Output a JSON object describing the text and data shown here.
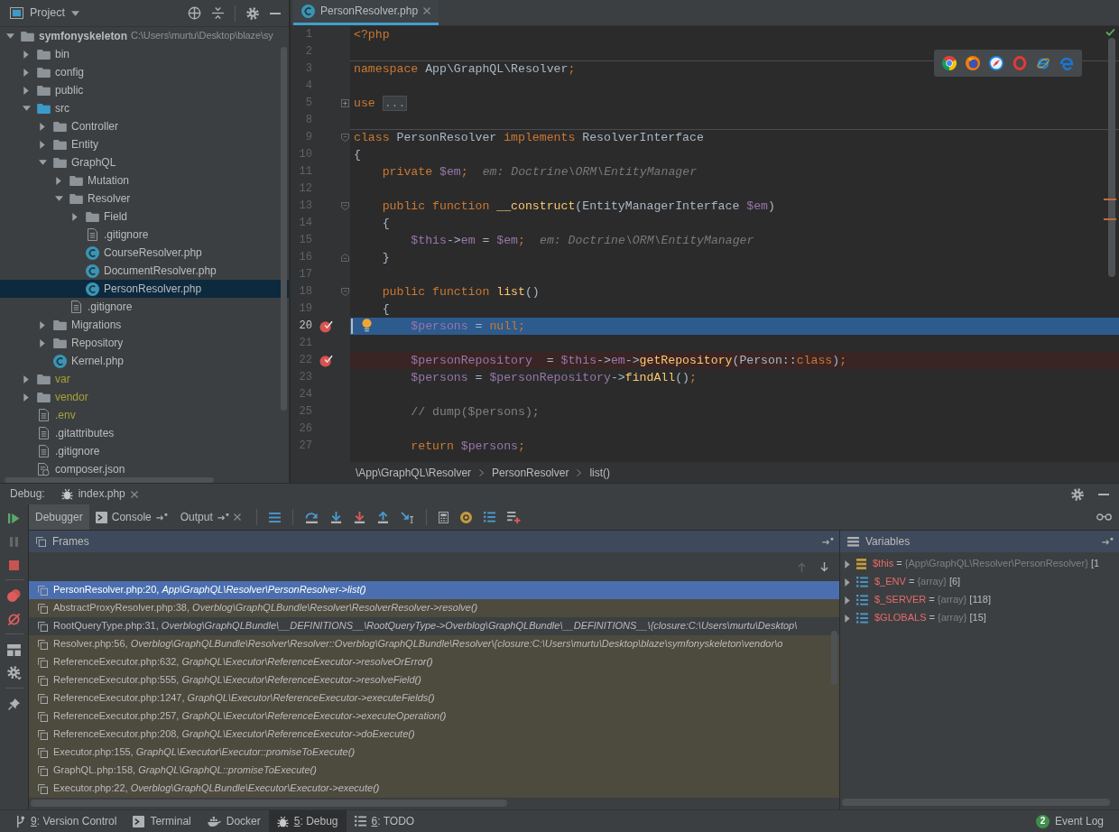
{
  "project": {
    "title": "Project",
    "tree": [
      {
        "label": "symfonyskeleton",
        "path": "C:\\Users\\murtu\\Desktop\\blaze\\sy",
        "kind": "module",
        "expanded": true,
        "selected": false,
        "ignored": false,
        "children": [
          {
            "label": "bin",
            "kind": "folder",
            "expanded": false,
            "selected": false,
            "ignored": false
          },
          {
            "label": "config",
            "kind": "folder",
            "expanded": false,
            "selected": false,
            "ignored": false
          },
          {
            "label": "public",
            "kind": "folder",
            "expanded": false,
            "selected": false,
            "ignored": false
          },
          {
            "label": "src",
            "kind": "source_folder",
            "expanded": true,
            "selected": false,
            "ignored": false,
            "children": [
              {
                "label": "Controller",
                "kind": "folder",
                "expanded": false,
                "selected": false,
                "ignored": false
              },
              {
                "label": "Entity",
                "kind": "folder",
                "expanded": false,
                "selected": false,
                "ignored": false
              },
              {
                "label": "GraphQL",
                "kind": "folder",
                "expanded": true,
                "selected": false,
                "ignored": false,
                "children": [
                  {
                    "label": "Mutation",
                    "kind": "folder",
                    "expanded": false,
                    "selected": false,
                    "ignored": false
                  },
                  {
                    "label": "Resolver",
                    "kind": "folder",
                    "expanded": true,
                    "selected": false,
                    "ignored": false,
                    "children": [
                      {
                        "label": "Field",
                        "kind": "folder",
                        "expanded": false,
                        "selected": false,
                        "ignored": false
                      },
                      {
                        "label": ".gitignore",
                        "kind": "text_file",
                        "selected": false,
                        "ignored": false
                      },
                      {
                        "label": "CourseResolver.php",
                        "kind": "class_file",
                        "selected": false,
                        "ignored": false
                      },
                      {
                        "label": "DocumentResolver.php",
                        "kind": "class_file",
                        "selected": false,
                        "ignored": false
                      },
                      {
                        "label": "PersonResolver.php",
                        "kind": "class_file",
                        "selected": true,
                        "ignored": false
                      }
                    ]
                  },
                  {
                    "label": ".gitignore",
                    "kind": "text_file",
                    "selected": false,
                    "ignored": false
                  }
                ]
              },
              {
                "label": "Migrations",
                "kind": "folder",
                "expanded": false,
                "selected": false,
                "ignored": false
              },
              {
                "label": "Repository",
                "kind": "folder",
                "expanded": false,
                "selected": false,
                "ignored": false
              },
              {
                "label": "Kernel.php",
                "kind": "class_file",
                "selected": false,
                "ignored": false
              }
            ]
          },
          {
            "label": "var",
            "kind": "folder",
            "expanded": false,
            "selected": false,
            "ignored": true
          },
          {
            "label": "vendor",
            "kind": "folder",
            "expanded": false,
            "selected": false,
            "ignored": true
          },
          {
            "label": ".env",
            "kind": "text_file",
            "selected": false,
            "ignored": true
          },
          {
            "label": ".gitattributes",
            "kind": "text_file",
            "selected": false,
            "ignored": false
          },
          {
            "label": ".gitignore",
            "kind": "text_file",
            "selected": false,
            "ignored": false
          },
          {
            "label": "composer.json",
            "kind": "json_file",
            "selected": false,
            "ignored": false
          }
        ]
      }
    ]
  },
  "editor": {
    "tab": {
      "label": "PersonResolver.php",
      "selected": true
    },
    "lines": [
      {
        "number": "1",
        "breakpoint": false,
        "current": false,
        "tokens": [
          {
            "kind": "keyword",
            "text": "<?php"
          }
        ]
      },
      {
        "number": "2",
        "breakpoint": false,
        "current": false
      },
      {
        "number": "3",
        "breakpoint": false,
        "current": false,
        "separator": true,
        "tokens": [
          {
            "kind": "keyword",
            "text": "namespace"
          },
          {
            "kind": "plain",
            "text": " App\\GraphQL\\Resolver"
          },
          {
            "kind": "keyword",
            "text": ";"
          }
        ]
      },
      {
        "number": "4",
        "breakpoint": false,
        "current": false
      },
      {
        "number": "5",
        "breakpoint": false,
        "current": false,
        "fold": {
          "kind": "collapsed"
        },
        "tokens": [
          {
            "kind": "keyword",
            "text": "use "
          },
          {
            "kind": "folded",
            "text": "..."
          }
        ]
      },
      {
        "number": "8",
        "breakpoint": false,
        "current": false
      },
      {
        "number": "9",
        "breakpoint": false,
        "current": false,
        "separator": true,
        "fold": {
          "kind": "open"
        },
        "tokens": [
          {
            "kind": "keyword",
            "text": "class"
          },
          {
            "kind": "plain",
            "text": " PersonResolver "
          },
          {
            "kind": "keyword",
            "text": "implements"
          },
          {
            "kind": "plain",
            "text": " ResolverInterface"
          }
        ]
      },
      {
        "number": "10",
        "breakpoint": false,
        "current": false,
        "tokens": [
          {
            "kind": "plain",
            "text": "{"
          }
        ]
      },
      {
        "number": "11",
        "breakpoint": false,
        "current": false,
        "tokens": [
          {
            "kind": "keyword",
            "text": "    private "
          },
          {
            "kind": "variable",
            "text": "$em"
          },
          {
            "kind": "keyword",
            "text": ";"
          },
          {
            "kind": "hint",
            "text": "em: Doctrine\\ORM\\EntityManager"
          }
        ]
      },
      {
        "number": "12",
        "breakpoint": false,
        "current": false
      },
      {
        "number": "13",
        "breakpoint": false,
        "current": false,
        "fold": {
          "kind": "open"
        },
        "tokens": [
          {
            "kind": "keyword",
            "text": "    public function "
          },
          {
            "kind": "function",
            "text": "__construct"
          },
          {
            "kind": "plain",
            "text": "(EntityManagerInterface "
          },
          {
            "kind": "variable",
            "text": "$em"
          },
          {
            "kind": "plain",
            "text": ")"
          }
        ]
      },
      {
        "number": "14",
        "breakpoint": false,
        "current": false,
        "tokens": [
          {
            "kind": "plain",
            "text": "    {"
          }
        ]
      },
      {
        "number": "15",
        "breakpoint": false,
        "current": false,
        "tokens": [
          {
            "kind": "variable",
            "text": "        $this"
          },
          {
            "kind": "plain",
            "text": "->"
          },
          {
            "kind": "variable",
            "text": "em"
          },
          {
            "kind": "plain",
            "text": " = "
          },
          {
            "kind": "variable",
            "text": "$em"
          },
          {
            "kind": "keyword",
            "text": ";"
          },
          {
            "kind": "hint",
            "text": "em: Doctrine\\ORM\\EntityManager"
          }
        ]
      },
      {
        "number": "16",
        "breakpoint": false,
        "current": false,
        "fold": {
          "kind": "close"
        },
        "tokens": [
          {
            "kind": "plain",
            "text": "    }"
          }
        ]
      },
      {
        "number": "17",
        "breakpoint": false,
        "current": false
      },
      {
        "number": "18",
        "breakpoint": false,
        "current": false,
        "fold": {
          "kind": "open"
        },
        "tokens": [
          {
            "kind": "keyword",
            "text": "    public function "
          },
          {
            "kind": "function",
            "text": "list"
          },
          {
            "kind": "plain",
            "text": "()"
          }
        ]
      },
      {
        "number": "19",
        "breakpoint": false,
        "current": false,
        "tokens": [
          {
            "kind": "plain",
            "text": "    {"
          }
        ]
      },
      {
        "number": "20",
        "breakpoint": true,
        "current": true,
        "caret": true,
        "bulb": true,
        "tokens": [
          {
            "kind": "variable",
            "text": "        $persons"
          },
          {
            "kind": "plain",
            "text": " = "
          },
          {
            "kind": "keyword",
            "text": "null"
          },
          {
            "kind": "keyword",
            "text": ";"
          }
        ]
      },
      {
        "number": "21",
        "breakpoint": false,
        "current": false
      },
      {
        "number": "22",
        "breakpoint": true,
        "current": false,
        "tokens": [
          {
            "kind": "variable",
            "text": "        $personRepository"
          },
          {
            "kind": "plain",
            "text": "  = "
          },
          {
            "kind": "variable",
            "text": "$this"
          },
          {
            "kind": "plain",
            "text": "->"
          },
          {
            "kind": "variable",
            "text": "em"
          },
          {
            "kind": "plain",
            "text": "->"
          },
          {
            "kind": "function",
            "text": "getRepository"
          },
          {
            "kind": "plain",
            "text": "(Person::"
          },
          {
            "kind": "keyword",
            "text": "class"
          },
          {
            "kind": "plain",
            "text": ")"
          },
          {
            "kind": "keyword",
            "text": ";"
          }
        ]
      },
      {
        "number": "23",
        "breakpoint": false,
        "current": false,
        "tokens": [
          {
            "kind": "variable",
            "text": "        $persons"
          },
          {
            "kind": "plain",
            "text": " = "
          },
          {
            "kind": "variable",
            "text": "$personRepository"
          },
          {
            "kind": "plain",
            "text": "->"
          },
          {
            "kind": "function",
            "text": "findAll"
          },
          {
            "kind": "plain",
            "text": "()"
          },
          {
            "kind": "keyword",
            "text": ";"
          }
        ]
      },
      {
        "number": "24",
        "breakpoint": false,
        "current": false
      },
      {
        "number": "25",
        "breakpoint": false,
        "current": false,
        "tokens": [
          {
            "kind": "comment",
            "text": "        // dump($persons);"
          }
        ]
      },
      {
        "number": "26",
        "breakpoint": false,
        "current": false
      },
      {
        "number": "27",
        "breakpoint": false,
        "current": false,
        "tokens": [
          {
            "kind": "keyword",
            "text": "        return "
          },
          {
            "kind": "variable",
            "text": "$persons"
          },
          {
            "kind": "keyword",
            "text": ";"
          }
        ]
      }
    ],
    "breadcrumbs": [
      "\\App\\GraphQL\\Resolver",
      "PersonResolver",
      "list()"
    ]
  },
  "debug": {
    "title": "Debug:",
    "session_tab": "index.php",
    "tabs": [
      {
        "label": "Debugger",
        "kind": "debugger",
        "selected": true
      },
      {
        "label": "Console",
        "kind": "console",
        "selected": false
      },
      {
        "label": "Output",
        "kind": "output",
        "selected": false
      }
    ],
    "frames": {
      "title": "Frames",
      "rows": [
        {
          "text": "PersonResolver.php:20, *App\\GraphQL\\Resolver\\PersonResolver->list()*",
          "selected": true,
          "library": false
        },
        {
          "text": "AbstractProxyResolver.php:38, *Overblog\\GraphQLBundle\\Resolver\\ResolverResolver->resolve()*",
          "selected": false,
          "library": true
        },
        {
          "text": "RootQueryType.php:31, *Overblog\\GraphQLBundle\\__DEFINITIONS__\\RootQueryType->Overblog\\GraphQLBundle\\__DEFINITIONS__\\{closure:C:\\Users\\murtu\\Desktop\\*",
          "selected": false,
          "library": false
        },
        {
          "text": "Resolver.php:56, *Overblog\\GraphQLBundle\\Resolver\\Resolver::Overblog\\GraphQLBundle\\Resolver\\{closure:C:\\Users\\murtu\\Desktop\\blaze\\symfonyskeleton\\vendor\\o*",
          "selected": false,
          "library": true
        },
        {
          "text": "ReferenceExecutor.php:632, *GraphQL\\Executor\\ReferenceExecutor->resolveOrError()*",
          "selected": false,
          "library": true
        },
        {
          "text": "ReferenceExecutor.php:555, *GraphQL\\Executor\\ReferenceExecutor->resolveField()*",
          "selected": false,
          "library": true
        },
        {
          "text": "ReferenceExecutor.php:1247, *GraphQL\\Executor\\ReferenceExecutor->executeFields()*",
          "selected": false,
          "library": true
        },
        {
          "text": "ReferenceExecutor.php:257, *GraphQL\\Executor\\ReferenceExecutor->executeOperation()*",
          "selected": false,
          "library": true
        },
        {
          "text": "ReferenceExecutor.php:208, *GraphQL\\Executor\\ReferenceExecutor->doExecute()*",
          "selected": false,
          "library": true
        },
        {
          "text": "Executor.php:155, *GraphQL\\Executor\\Executor::promiseToExecute()*",
          "selected": false,
          "library": true
        },
        {
          "text": "GraphQL.php:158, *GraphQL\\GraphQL::promiseToExecute()*",
          "selected": false,
          "library": true
        },
        {
          "text": "Executor.php:22, *Overblog\\GraphQLBundle\\Executor\\Executor->execute()*",
          "selected": false,
          "library": true
        }
      ]
    },
    "variables": {
      "title": "Variables",
      "rows": [
        {
          "name": "$this",
          "equals": "=",
          "type": "{App\\GraphQL\\Resolver\\PersonResolver}",
          "size": "[1",
          "kind": "object",
          "expanded": false
        },
        {
          "name": "$_ENV",
          "equals": "=",
          "type": "{array}",
          "size": "[6]",
          "kind": "array",
          "expanded": false
        },
        {
          "name": "$_SERVER",
          "equals": "=",
          "type": "{array}",
          "size": "[118]",
          "kind": "array",
          "expanded": false
        },
        {
          "name": "$GLOBALS",
          "equals": "=",
          "type": "{array}",
          "size": "[15]",
          "kind": "array",
          "expanded": false
        }
      ]
    }
  },
  "status_bar": {
    "tools": [
      {
        "key": "9:",
        "label": "Version Control",
        "kind": "vcs",
        "selected": false
      },
      {
        "label": "Terminal",
        "kind": "terminal",
        "selected": false
      },
      {
        "label": "Docker",
        "kind": "docker",
        "selected": false
      },
      {
        "key": "5:",
        "label": "Debug",
        "kind": "debug",
        "selected": true
      },
      {
        "key": "6:",
        "label": "TODO",
        "kind": "todo",
        "selected": false
      }
    ],
    "event_log": {
      "count": "2",
      "label": "Event Log"
    }
  }
}
